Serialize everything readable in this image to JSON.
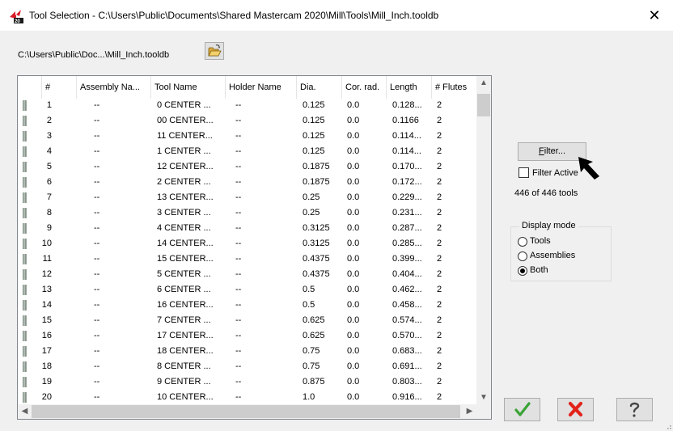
{
  "window": {
    "title": "Tool Selection - C:\\Users\\Public\\Documents\\Shared Mastercam 2020\\Mill\\Tools\\Mill_Inch.tooldb",
    "close_glyph": "✕"
  },
  "library": {
    "path": "C:\\Users\\Public\\Doc...\\Mill_Inch.tooldb",
    "browse_icon": "folder-open-icon"
  },
  "table": {
    "columns": [
      "#",
      "Assembly Na...",
      "Tool Name",
      "Holder Name",
      "Dia.",
      "Cor. rad.",
      "Length",
      "# Flutes"
    ],
    "rows": [
      [
        "1",
        "--",
        "0 CENTER ...",
        "--",
        "0.125",
        "0.0",
        "0.128...",
        "2"
      ],
      [
        "2",
        "--",
        "00 CENTER...",
        "--",
        "0.125",
        "0.0",
        "0.1166",
        "2"
      ],
      [
        "3",
        "--",
        "11 CENTER...",
        "--",
        "0.125",
        "0.0",
        "0.114...",
        "2"
      ],
      [
        "4",
        "--",
        "1 CENTER ...",
        "--",
        "0.125",
        "0.0",
        "0.114...",
        "2"
      ],
      [
        "5",
        "--",
        "12 CENTER...",
        "--",
        "0.1875",
        "0.0",
        "0.170...",
        "2"
      ],
      [
        "6",
        "--",
        "2 CENTER ...",
        "--",
        "0.1875",
        "0.0",
        "0.172...",
        "2"
      ],
      [
        "7",
        "--",
        "13 CENTER...",
        "--",
        "0.25",
        "0.0",
        "0.229...",
        "2"
      ],
      [
        "8",
        "--",
        "3 CENTER ...",
        "--",
        "0.25",
        "0.0",
        "0.231...",
        "2"
      ],
      [
        "9",
        "--",
        "4 CENTER ...",
        "--",
        "0.3125",
        "0.0",
        "0.287...",
        "2"
      ],
      [
        "10",
        "--",
        "14 CENTER...",
        "--",
        "0.3125",
        "0.0",
        "0.285...",
        "2"
      ],
      [
        "11",
        "--",
        "15 CENTER...",
        "--",
        "0.4375",
        "0.0",
        "0.399...",
        "2"
      ],
      [
        "12",
        "--",
        "5 CENTER ...",
        "--",
        "0.4375",
        "0.0",
        "0.404...",
        "2"
      ],
      [
        "13",
        "--",
        "6 CENTER ...",
        "--",
        "0.5",
        "0.0",
        "0.462...",
        "2"
      ],
      [
        "14",
        "--",
        "16 CENTER...",
        "--",
        "0.5",
        "0.0",
        "0.458...",
        "2"
      ],
      [
        "15",
        "--",
        "7 CENTER ...",
        "--",
        "0.625",
        "0.0",
        "0.574...",
        "2"
      ],
      [
        "16",
        "--",
        "17 CENTER...",
        "--",
        "0.625",
        "0.0",
        "0.570...",
        "2"
      ],
      [
        "17",
        "--",
        "18 CENTER...",
        "--",
        "0.75",
        "0.0",
        "0.683...",
        "2"
      ],
      [
        "18",
        "--",
        "8 CENTER ...",
        "--",
        "0.75",
        "0.0",
        "0.691...",
        "2"
      ],
      [
        "19",
        "--",
        "9 CENTER ...",
        "--",
        "0.875",
        "0.0",
        "0.803...",
        "2"
      ],
      [
        "20",
        "--",
        "10 CENTER...",
        "--",
        "1.0",
        "0.0",
        "0.916...",
        "2"
      ]
    ]
  },
  "filter": {
    "button_label_first": "F",
    "button_label_rest": "ilter...",
    "active_label": "Filter Active",
    "active_checked": false,
    "count_text": "446 of 446 tools"
  },
  "display_mode": {
    "label": "Display mode",
    "options": [
      "Tools",
      "Assemblies",
      "Both"
    ],
    "selected": "Both"
  },
  "actions": {
    "ok_icon": "checkmark-icon",
    "cancel_icon": "red-x-icon",
    "help_icon": "question-icon"
  },
  "colors": {
    "ok_green": "#3aa335",
    "cancel_red": "#e2231a",
    "grid_border": "#828790"
  }
}
